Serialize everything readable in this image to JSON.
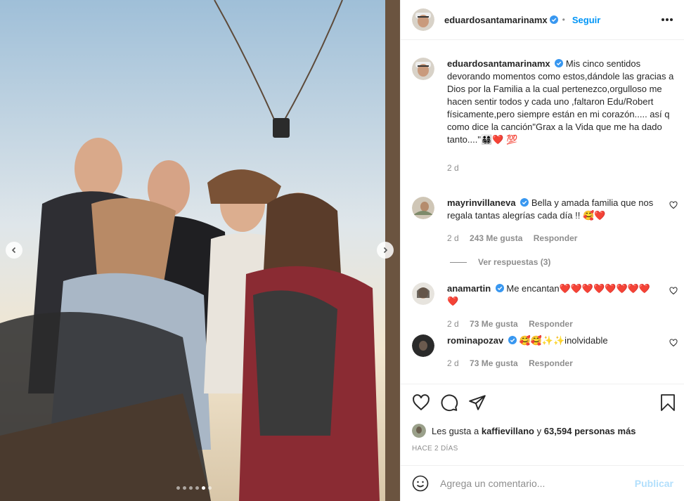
{
  "post": {
    "username": "eduardosantamarinamx",
    "follow_label": "Seguir",
    "more_icon": "more-icon"
  },
  "caption": {
    "username": "eduardosantamarinamx",
    "text": "Mis cinco sentidos devorando momentos como estos,dándole las gracias a Dios por la Familia a la cual pertenezco,orgulloso me hacen sentir todos y cada uno ,faltaron Edu/Robert físicamente,pero siempre están en mi corazón..... así q como dice la canción\"Grax a la Vida que me ha dado tanto....\"👨‍👩‍👧‍👦❤️ 💯",
    "age": "2 d"
  },
  "comments": [
    {
      "username": "mayrinvillaneva",
      "text": "Bella y amada familia que nos regala tantas alegrías cada día !! 🥰❤️",
      "age": "2 d",
      "likes": "243 Me gusta",
      "reply": "Responder"
    },
    {
      "username": "anamartin",
      "text": "Me encantan❤️❤️❤️❤️❤️❤️❤️❤️❤️",
      "age": "2 d",
      "likes": "73 Me gusta",
      "reply": "Responder"
    },
    {
      "username": "rominapozav",
      "text": "🥰🥰✨✨inolvidable",
      "age": "2 d",
      "likes": "73 Me gusta",
      "reply": "Responder"
    }
  ],
  "view_replies": "Ver respuestas (3)",
  "likes_summary": {
    "prefix": "Les gusta a",
    "user": "kaffievillano",
    "connector": "y",
    "others": "63,594 personas más"
  },
  "posted_time": "HACE 2 DÍAS",
  "comment_box": {
    "placeholder": "Agrega un comentario...",
    "publish_label": "Publicar"
  },
  "carousel": {
    "count": 6,
    "active_index": 3
  },
  "colors": {
    "accent": "#0095f6",
    "verified": "#3897f0",
    "publish_disabled": "#b2dffc"
  }
}
